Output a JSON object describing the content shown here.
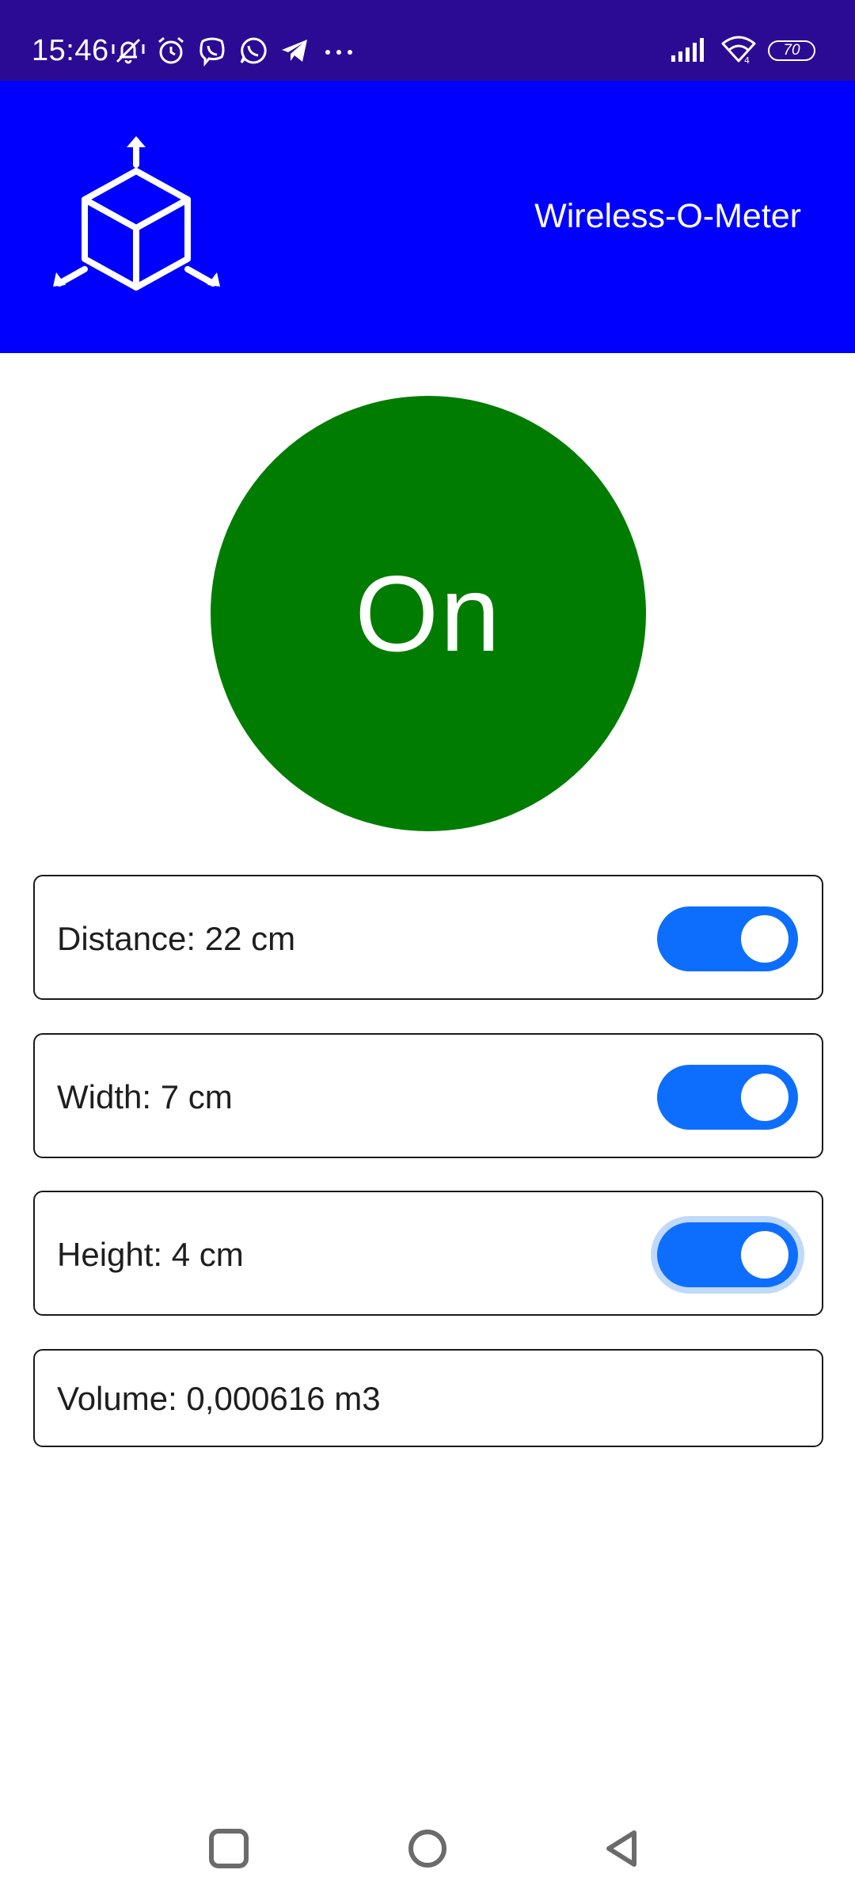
{
  "status_bar": {
    "time": "15:46",
    "battery_level": "70",
    "background_color": "#2c0b94",
    "icons_left": [
      "mute-vibrate-icon",
      "alarm-icon",
      "viber-icon",
      "whatsapp-icon",
      "telegram-icon",
      "more-notifications-icon"
    ],
    "icons_right": [
      "signal-icon",
      "wifi-icon",
      "battery-icon"
    ]
  },
  "app_bar": {
    "title": "Wireless-O-Meter",
    "logo_icon": "cube-axes-icon",
    "background_color": "#0000ff"
  },
  "power_button": {
    "label": "On",
    "color": "#007d00"
  },
  "measurements": {
    "distance": {
      "label": "Distance: 22 cm",
      "enabled": true
    },
    "width": {
      "label": "Width: 7 cm",
      "enabled": true
    },
    "height": {
      "label": "Height: 4 cm",
      "enabled": true,
      "focused": true
    },
    "volume": {
      "label": "Volume: 0,000616 m3"
    }
  },
  "toggle_color": "#0d6efd",
  "nav_bar": {
    "buttons": [
      "recents-square-icon",
      "home-circle-icon",
      "back-triangle-icon"
    ]
  }
}
